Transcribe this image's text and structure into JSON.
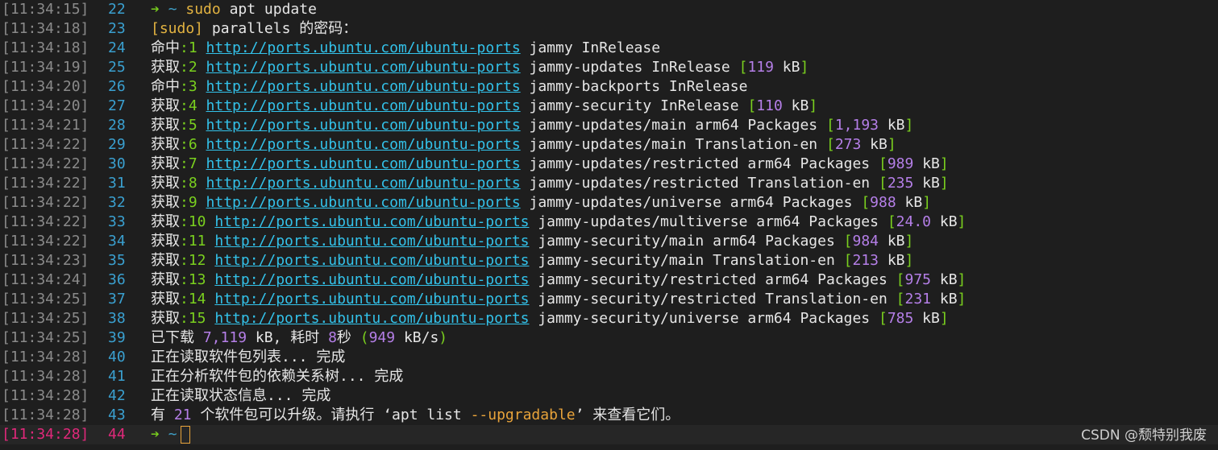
{
  "colors": {
    "background": "#1e1e1e",
    "timestamp": "#8a8a8a",
    "line_number": "#3aa0d0",
    "arrow": "#7ad01e",
    "url": "#33c2ea",
    "number": "#b57fe8",
    "bracket": "#7ad01e",
    "sudo": "#e3b341",
    "current_line": "#e0287a"
  },
  "lines": [
    {
      "ts": "[11:34:15]",
      "n": "22",
      "prompt_arrow": "➔",
      "prompt_dir": "~",
      "cmd_a": "sudo",
      "cmd_b": " apt update"
    },
    {
      "ts": "[11:34:18]",
      "n": "23",
      "sudo": "[sudo]",
      "text": " parallels 的密码："
    },
    {
      "ts": "[11:34:18]",
      "n": "24",
      "verb": "命中",
      "idx": ":1",
      "url": "http://ports.ubuntu.com/ubuntu-ports",
      "desc": " jammy InRelease"
    },
    {
      "ts": "[11:34:19]",
      "n": "25",
      "verb": "获取",
      "idx": ":2",
      "url": "http://ports.ubuntu.com/ubuntu-ports",
      "desc": " jammy-updates InRelease ",
      "size": "119",
      "unit": " kB"
    },
    {
      "ts": "[11:34:20]",
      "n": "26",
      "verb": "命中",
      "idx": ":3",
      "url": "http://ports.ubuntu.com/ubuntu-ports",
      "desc": " jammy-backports InRelease"
    },
    {
      "ts": "[11:34:20]",
      "n": "27",
      "verb": "获取",
      "idx": ":4",
      "url": "http://ports.ubuntu.com/ubuntu-ports",
      "desc": " jammy-security InRelease ",
      "size": "110",
      "unit": " kB"
    },
    {
      "ts": "[11:34:21]",
      "n": "28",
      "verb": "获取",
      "idx": ":5",
      "url": "http://ports.ubuntu.com/ubuntu-ports",
      "desc": " jammy-updates/main arm64 Packages ",
      "size": "1,193",
      "unit": " kB"
    },
    {
      "ts": "[11:34:22]",
      "n": "29",
      "verb": "获取",
      "idx": ":6",
      "url": "http://ports.ubuntu.com/ubuntu-ports",
      "desc": " jammy-updates/main Translation-en ",
      "size": "273",
      "unit": " kB"
    },
    {
      "ts": "[11:34:22]",
      "n": "30",
      "verb": "获取",
      "idx": ":7",
      "url": "http://ports.ubuntu.com/ubuntu-ports",
      "desc": " jammy-updates/restricted arm64 Packages ",
      "size": "989",
      "unit": " kB"
    },
    {
      "ts": "[11:34:22]",
      "n": "31",
      "verb": "获取",
      "idx": ":8",
      "url": "http://ports.ubuntu.com/ubuntu-ports",
      "desc": " jammy-updates/restricted Translation-en ",
      "size": "235",
      "unit": " kB"
    },
    {
      "ts": "[11:34:22]",
      "n": "32",
      "verb": "获取",
      "idx": ":9",
      "url": "http://ports.ubuntu.com/ubuntu-ports",
      "desc": " jammy-updates/universe arm64 Packages ",
      "size": "988",
      "unit": " kB"
    },
    {
      "ts": "[11:34:22]",
      "n": "33",
      "verb": "获取",
      "idx": ":10",
      "url": "http://ports.ubuntu.com/ubuntu-ports",
      "desc": " jammy-updates/multiverse arm64 Packages ",
      "size": "24.0",
      "unit": " kB"
    },
    {
      "ts": "[11:34:22]",
      "n": "34",
      "verb": "获取",
      "idx": ":11",
      "url": "http://ports.ubuntu.com/ubuntu-ports",
      "desc": " jammy-security/main arm64 Packages ",
      "size": "984",
      "unit": " kB"
    },
    {
      "ts": "[11:34:23]",
      "n": "35",
      "verb": "获取",
      "idx": ":12",
      "url": "http://ports.ubuntu.com/ubuntu-ports",
      "desc": " jammy-security/main Translation-en ",
      "size": "213",
      "unit": " kB"
    },
    {
      "ts": "[11:34:24]",
      "n": "36",
      "verb": "获取",
      "idx": ":13",
      "url": "http://ports.ubuntu.com/ubuntu-ports",
      "desc": " jammy-security/restricted arm64 Packages ",
      "size": "975",
      "unit": " kB"
    },
    {
      "ts": "[11:34:25]",
      "n": "37",
      "verb": "获取",
      "idx": ":14",
      "url": "http://ports.ubuntu.com/ubuntu-ports",
      "desc": " jammy-security/restricted Translation-en ",
      "size": "231",
      "unit": " kB"
    },
    {
      "ts": "[11:34:25]",
      "n": "38",
      "verb": "获取",
      "idx": ":15",
      "url": "http://ports.ubuntu.com/ubuntu-ports",
      "desc": " jammy-security/universe arm64 Packages ",
      "size": "785",
      "unit": " kB"
    },
    {
      "ts": "[11:34:25]",
      "n": "39",
      "summary": true,
      "a": "已下载 ",
      "b": "7,119",
      "c": " kB, 耗时 ",
      "d": "8",
      "e": "秒 ",
      "f": "(",
      "g": "949",
      "h": " kB/s",
      "i": ")"
    },
    {
      "ts": "[11:34:28]",
      "n": "40",
      "text": "正在读取软件包列表... 完成"
    },
    {
      "ts": "[11:34:28]",
      "n": "41",
      "text": "正在分析软件包的依赖关系树... 完成"
    },
    {
      "ts": "[11:34:28]",
      "n": "42",
      "text": "正在读取状态信息... 完成"
    },
    {
      "ts": "[11:34:28]",
      "n": "43",
      "up": true,
      "a": "有 ",
      "b": "21",
      "c": " 个软件包可以升级。请执行 ‘apt list ",
      "d": "--upgradable",
      "e": "’ 来查看它们。"
    },
    {
      "ts": "[11:34:28]",
      "n": "44",
      "prompt_arrow": "➔",
      "prompt_dir": "~",
      "current": true
    }
  ],
  "watermark": "CSDN @颓特别我废"
}
